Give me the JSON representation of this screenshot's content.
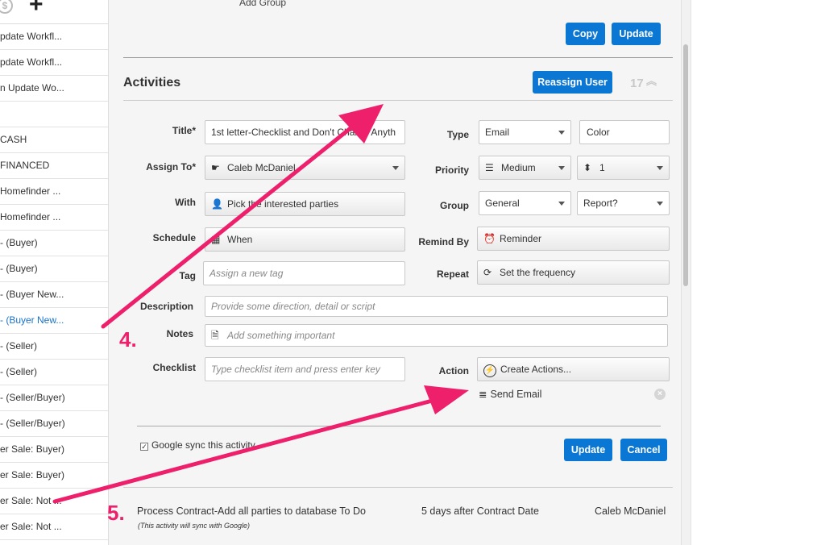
{
  "sidebar": {
    "items": [
      {
        "label": "pdate Workfl..."
      },
      {
        "label": "pdate Workfl..."
      },
      {
        "label": "n Update Wo..."
      },
      {
        "label": ""
      },
      {
        "label": " CASH"
      },
      {
        "label": " FINANCED"
      },
      {
        "label": " Homefinder ..."
      },
      {
        "label": " Homefinder ..."
      },
      {
        "label": "- (Buyer)"
      },
      {
        "label": "- (Buyer)"
      },
      {
        "label": "- (Buyer New..."
      },
      {
        "label": "- (Buyer New..."
      },
      {
        "label": "- (Seller)"
      },
      {
        "label": "- (Seller)"
      },
      {
        "label": "- (Seller/Buyer)"
      },
      {
        "label": "- (Seller/Buyer)"
      },
      {
        "label": "er Sale: Buyer)"
      },
      {
        "label": "er Sale: Buyer)"
      },
      {
        "label": "er Sale: Not ..."
      },
      {
        "label": "er Sale: Not ..."
      }
    ],
    "active_index": 11
  },
  "header": {
    "add_group": "Add Group",
    "copy_label": "Copy",
    "update_label": "Update"
  },
  "activities": {
    "title": "Activities",
    "reassign_label": "Reassign User",
    "count": "17"
  },
  "form": {
    "title_label": "Title*",
    "title_value": "1st letter-Checklist and Don't Charge Anyth",
    "type_label": "Type",
    "type_value": "Email",
    "color_value": "Color",
    "assign_label": "Assign To*",
    "assign_value": "Caleb McDaniel",
    "priority_label": "Priority",
    "priority_value": "Medium",
    "priority_num": "1",
    "with_label": "With",
    "with_placeholder": "Pick the interested parties",
    "group_label": "Group",
    "group_value": "General",
    "report_value": "Report?",
    "schedule_label": "Schedule",
    "schedule_value": "When",
    "remind_label": "Remind By",
    "remind_value": "Reminder",
    "tag_label": "Tag",
    "tag_placeholder": "Assign a new tag",
    "repeat_label": "Repeat",
    "repeat_value": "Set the frequency",
    "description_label": "Description",
    "description_placeholder": "Provide some direction, detail or script",
    "notes_label": "Notes",
    "notes_placeholder": "Add something important",
    "checklist_label": "Checklist",
    "checklist_placeholder": "Type checklist item and press enter key",
    "action_label": "Action",
    "action_value": "Create Actions...",
    "send_email": "Send Email",
    "google_sync": "Google sync this activity",
    "update_label": "Update",
    "cancel_label": "Cancel"
  },
  "next_activity": {
    "title": "Process Contract-Add all parties to database To Do",
    "note": "(This activity will sync with Google)",
    "timing": "5 days after Contract Date",
    "user": "Caleb McDaniel"
  },
  "annotations": {
    "step4": "4.",
    "step5": "5.",
    "arrow_color": "#ee1f6b"
  },
  "icons": {
    "coin": "dollar-coin-icon",
    "plus": "plus-icon",
    "hand": "pointing-hand-icon",
    "list": "list-icon",
    "updown": "sort-arrows-icon",
    "person": "person-icon",
    "calendar": "calendar-icon",
    "alarm": "alarm-clock-icon",
    "repeat": "repeat-icon",
    "document": "document-icon",
    "lightning": "lightning-icon",
    "email_list": "send-email-icon",
    "remove": "remove-circle-icon"
  }
}
